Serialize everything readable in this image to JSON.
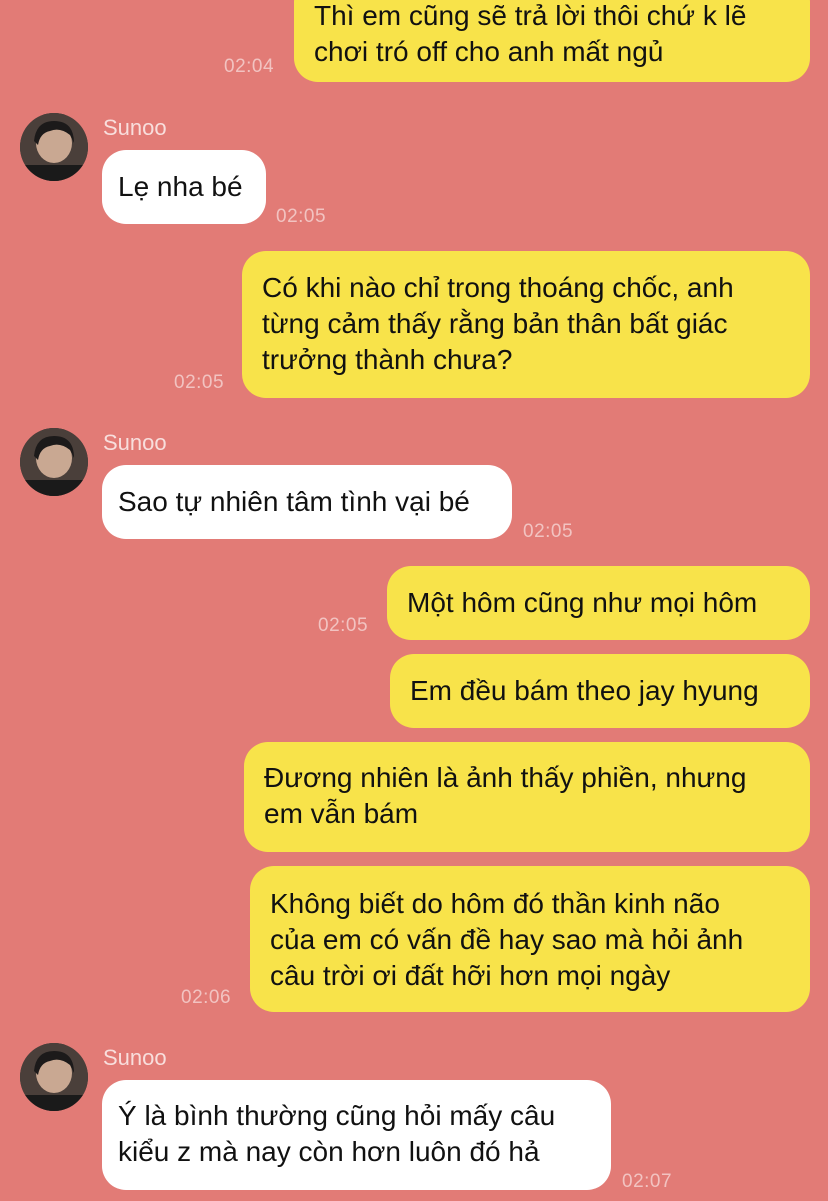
{
  "colors": {
    "background": "#e27b76",
    "outgoing_bubble": "#f8e34a",
    "incoming_bubble": "#ffffff"
  },
  "contact": {
    "name": "Sunoo",
    "avatar_icon": "profile-photo-icon"
  },
  "messages": [
    {
      "dir": "out",
      "text": "Thì em cũng sẽ trả lời thôi chứ k lẽ\nchơi tró off cho anh mất ngủ",
      "time": "02:04"
    },
    {
      "dir": "in",
      "sender": "Sunoo",
      "text": "Lẹ nha bé",
      "time": "02:05"
    },
    {
      "dir": "out",
      "text": "Có khi nào chỉ trong thoáng chốc, anh\ntừng cảm thấy rằng bản thân bất giác\ntrưởng thành chưa?",
      "time": "02:05"
    },
    {
      "dir": "in",
      "sender": "Sunoo",
      "text": "Sao tự nhiên tâm tình vại bé",
      "time": "02:05"
    },
    {
      "dir": "out",
      "text": "Một hôm cũng như mọi hôm",
      "time": "02:05"
    },
    {
      "dir": "out",
      "text": "Em đều bám theo jay hyung",
      "time": ""
    },
    {
      "dir": "out",
      "text": "Đương nhiên là ảnh thấy phiền, nhưng\nem vẫn bám",
      "time": ""
    },
    {
      "dir": "out",
      "text": "Không biết do hôm đó thần kinh não\ncủa em có vấn đề hay sao mà hỏi ảnh\ncâu trời ơi đất hỡi hơn mọi ngày",
      "time": "02:06"
    },
    {
      "dir": "in",
      "sender": "Sunoo",
      "text": "Ý là bình thường cũng hỏi mấy câu\nkiểu z mà nay còn hơn luôn đó hả",
      "time": "02:07"
    }
  ]
}
